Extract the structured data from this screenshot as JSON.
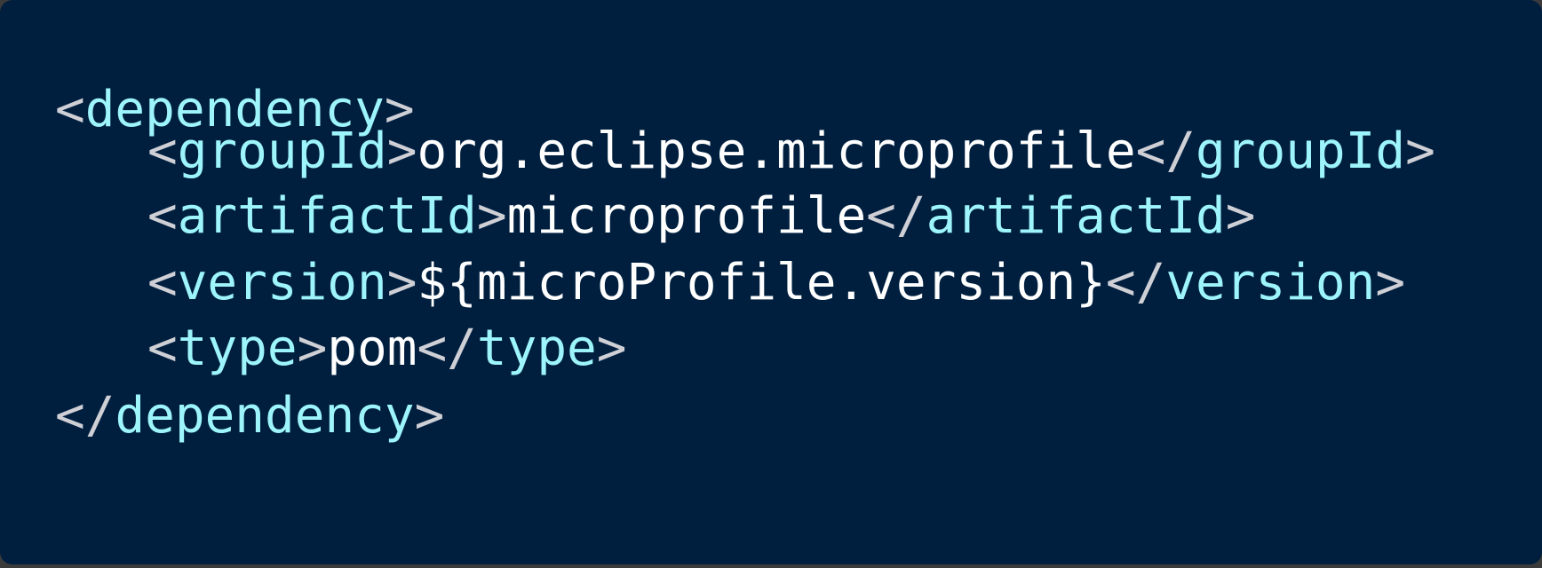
{
  "snippet": {
    "colors": {
      "background": "#001f3f",
      "tag": "#9df5fb",
      "punctuation": "#cfcfd6",
      "value": "#ffffff"
    },
    "lines": [
      {
        "open": "<",
        "tag": "dependency",
        "close": ">"
      },
      {
        "open": "<",
        "tag": "groupId",
        "close": ">",
        "value": "org.eclipse.microprofile",
        "end_open": "</",
        "end_tag": "groupId",
        "end_close": ">"
      },
      {
        "open": "<",
        "tag": "artifactId",
        "close": ">",
        "value": "microprofile",
        "end_open": "</",
        "end_tag": "artifactId",
        "end_close": ">"
      },
      {
        "open": "<",
        "tag": "version",
        "close": ">",
        "value": "${microProfile.version}",
        "end_open": "</",
        "end_tag": "version",
        "end_close": ">"
      },
      {
        "open": "<",
        "tag": "type",
        "close": ">",
        "value": "pom",
        "end_open": "</",
        "end_tag": "type",
        "end_close": ">"
      },
      {
        "open": "</",
        "tag": "dependency",
        "close": ">"
      }
    ]
  }
}
